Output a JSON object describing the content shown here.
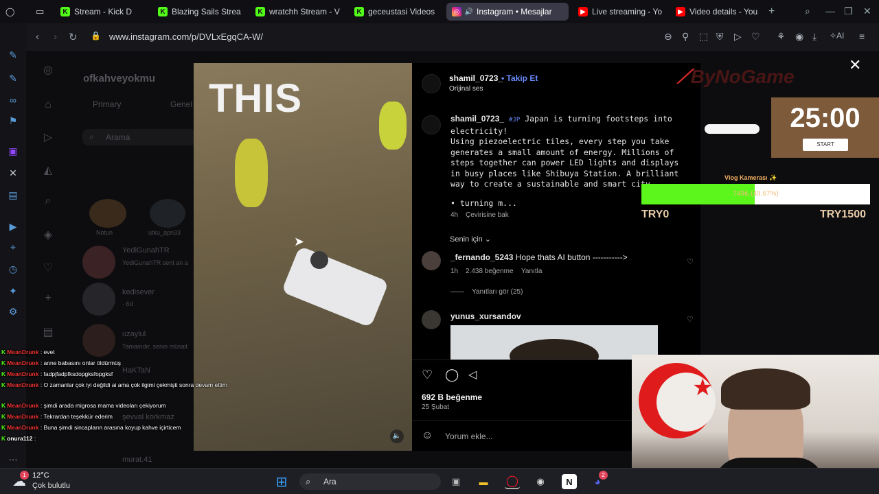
{
  "tabs": [
    {
      "label": "Stream - Kick D",
      "icon": "kick-icon",
      "active": false
    },
    {
      "label": "Blazing Sails Strea",
      "icon": "kick-icon",
      "active": false
    },
    {
      "label": "wratchh Stream - V",
      "icon": "kick-icon",
      "active": false
    },
    {
      "label": "gecеustasi Videos",
      "icon": "kick-icon",
      "active": false
    },
    {
      "label": "Instagram • Mesajlar",
      "icon": "instagram-icon",
      "active": true
    },
    {
      "label": "Live streaming - Yo",
      "icon": "youtube-icon",
      "active": false
    },
    {
      "label": "Video details - You",
      "icon": "youtube-icon",
      "active": false
    }
  ],
  "address": {
    "url": "www.instagram.com/p/DVLxEgqCA-W/"
  },
  "dm": {
    "username": "ofkahveyokmu",
    "tab_primary": "Primary",
    "tab_general": "Genel",
    "search_placeholder": "Arama",
    "notes": [
      {
        "label": "Notun"
      },
      {
        "label": "utku_apn33"
      }
    ],
    "threads": [
      {
        "name": "YediGunahTR",
        "preview": "YediGunahTR sent an a"
      },
      {
        "name": "kedisever",
        "preview": "· 6d"
      },
      {
        "name": "uzaylul",
        "preview": "Tamamdır, senin müsait"
      },
      {
        "name": "HaKTaN",
        "preview": ""
      },
      {
        "name": "şevval korkmaz",
        "preview": ""
      },
      {
        "name": "murat.41",
        "preview": ""
      }
    ]
  },
  "post": {
    "overlay_text": "THIS",
    "author": "shamil_0723_",
    "follow_label": "Takip Et",
    "audio": "Orijinal ses",
    "caption_author": "shamil_0723_",
    "caption_tag": "#JP",
    "caption_lines": [
      "Japan is turning footsteps into",
      "electricity!",
      "Using piezoelectric tiles, every step you take",
      "generates a small amount of energy. Millions of",
      "steps together can power LED lights and displays",
      "in busy places like Shibuya Station. A brilliant",
      "way to create a sustainable and smart city"
    ],
    "caption_more": "• turning m...",
    "caption_time": "4h",
    "translate_label": "Çevirisine bak",
    "for_you": "Senin için",
    "comments": [
      {
        "user": "_fernando_5243",
        "text": "Hope thats AI button ----------->",
        "time": "1h",
        "likes": "2.438 beğenme",
        "reply": "Yanıtla",
        "replies": "Yanıtları gör (25)"
      },
      {
        "user": "yunus_xursandov",
        "text": ""
      }
    ],
    "likes": "692 B beğenme",
    "date": "25 Şubat",
    "comment_placeholder": "Yorum ekle..."
  },
  "overlays": {
    "brand": "ByNoGame",
    "timer": "25:00",
    "timer_button": "START",
    "goal_title": "Vlog Kamerası ✨",
    "goal_text": "749₺ (49.67%)",
    "goal_fraction": 0.4967,
    "goal_min": "TRY0",
    "goal_max": "TRY1500"
  },
  "chat": [
    {
      "user": "MeanDrunk",
      "msg": ": evet"
    },
    {
      "user": "MeanDrunk",
      "msg": ": anne babasını onlar öldürmüş"
    },
    {
      "user": "MeanDrunk",
      "msg": ": fadpjfadpfksdopgksfopgksf"
    },
    {
      "user": "MeanDrunk",
      "msg": ": O zamanlar çok iyi değildi ai ama çok ilgimi çekmişti sonra devam ettim"
    },
    {
      "user": "MeanDrunk",
      "msg": ": şimdi arada migrosa mama videoları çekiyorum"
    },
    {
      "user": "MeanDrunk",
      "msg": ": Tekrardan teşekkür ederim"
    },
    {
      "user": "MeanDrunk",
      "msg": ": Buna şimdi sincapların arasına koyup kahve içirticem"
    },
    {
      "user": "onura112",
      "msg": ":"
    }
  ],
  "taskbar": {
    "weather_temp": "12°C",
    "weather_desc": "Çok bulutlu",
    "search_label": "Ara",
    "notification_count": "1",
    "discord_badge": "2"
  }
}
